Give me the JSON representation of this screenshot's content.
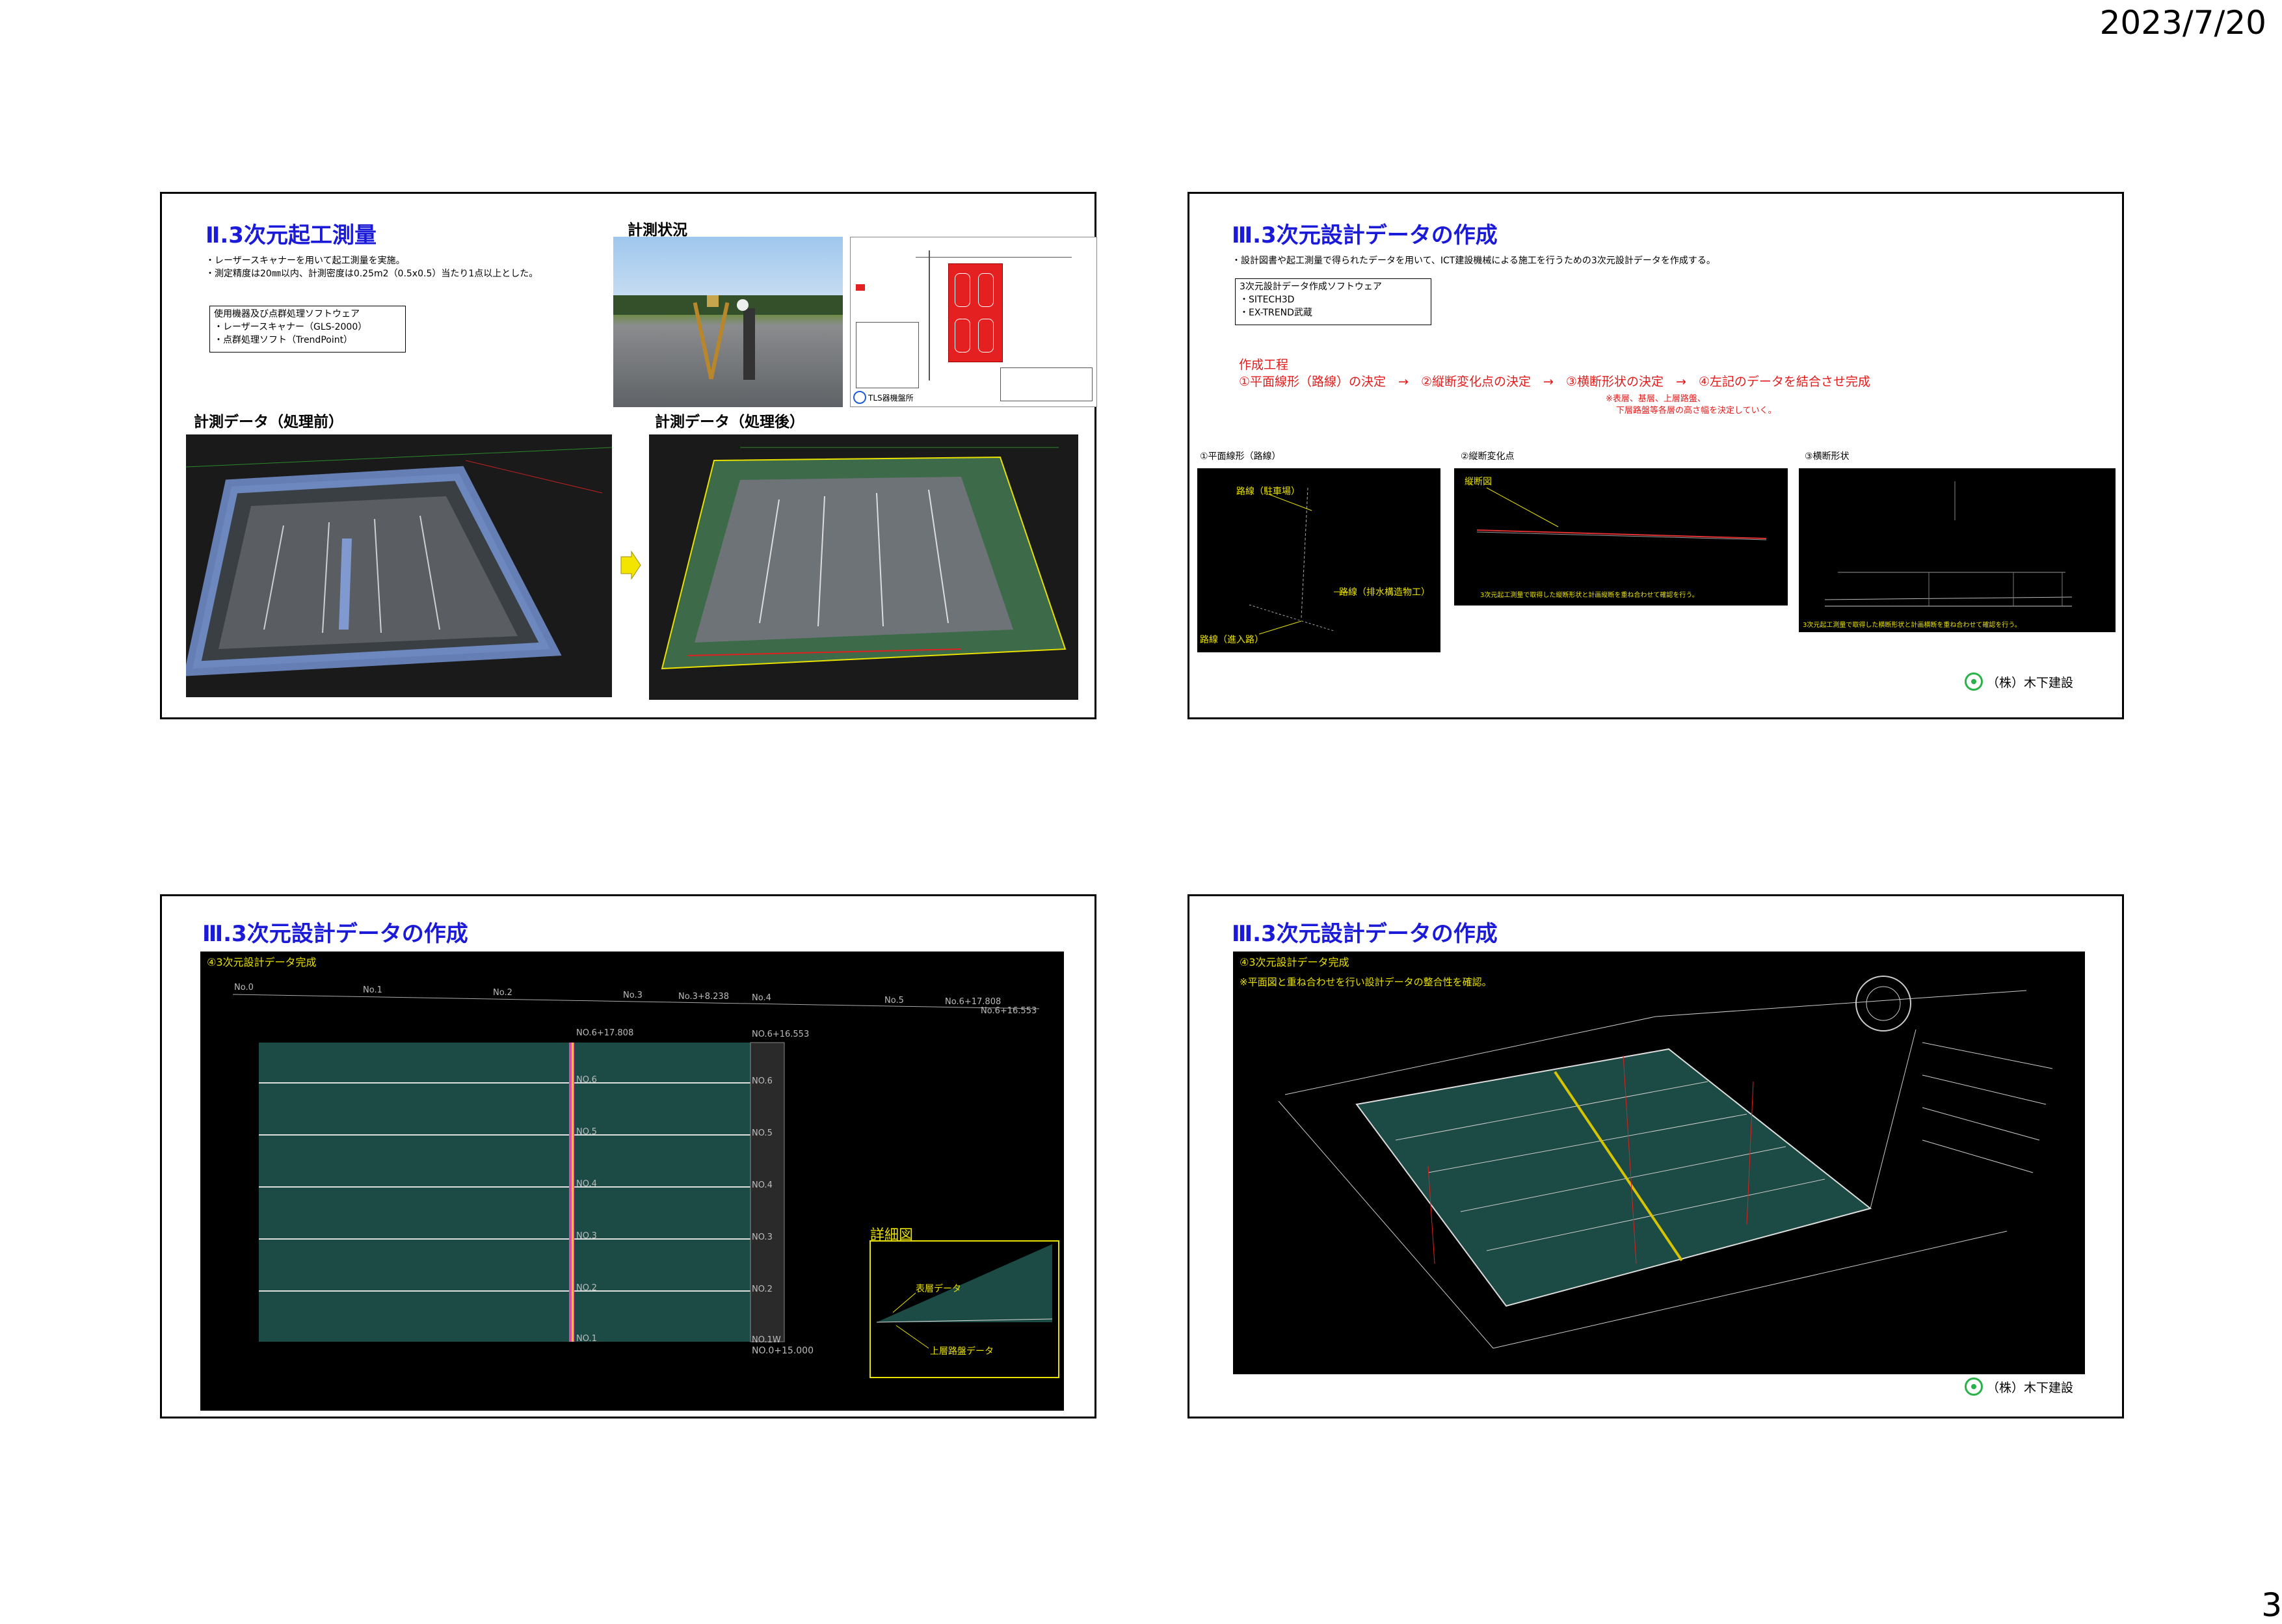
{
  "header": {
    "date": "2023/7/20"
  },
  "footer": {
    "page_number": "3"
  },
  "slide1": {
    "title": "Ⅱ.3次元起工測量",
    "bullets": [
      "・レーザースキャナーを用いて起工測量を実施。",
      "・測定精度は20㎜以内、計測密度は0.25m2（0.5x0.5）当たり1点以上とした。"
    ],
    "equipment_heading": "使用機器及び点群処理ソフトウェア",
    "equipment_items": [
      "・レーザースキャナー（GLS-2000）",
      "・点群処理ソフト（TrendPoint）"
    ],
    "photo_caption": "計測状況",
    "before_caption": "計測データ（処理前）",
    "after_caption": "計測データ（処理後）",
    "tls_label": "TLS器機盤所"
  },
  "slide2": {
    "title": "Ⅲ.3次元設計データの作成",
    "bullet": "・設計図書や起工測量で得られたデータを用いて、ICT建設機械による施工を行うための3次元設計データを作成する。",
    "software_heading": "3次元設計データ作成ソフトウェア",
    "software_items": [
      "・SITECH3D",
      "・EX-TREND武蔵"
    ],
    "process_heading": "作成工程",
    "process_line": "①平面線形（路線）の決定　→　②縦断変化点の決定　→　③横断形状の決定　→　④左記のデータを結合させ完成",
    "process_note1": "※表層、基層、上層路盤、",
    "process_note2": "下層路盤等各層の高さ幅を決定していく。",
    "panel1_caption": "①平面線形（路線）",
    "panel2_caption": "②縦断変化点",
    "panel3_caption": "③横断形状",
    "panel1_labels": [
      "路線（駐車場）",
      "路線（排水構造物工）",
      "路線（進入路）"
    ],
    "panel2_label": "縦断図",
    "panel2_note": "3次元起工測量で取得した縦断形状と計画縦断を重ね合わせて確認を行う。",
    "panel3_note": "3次元起工測量で取得した横断形状と計画横断を重ね合わせて確認を行う。",
    "company": "（株）木下建設"
  },
  "slide3": {
    "title": "Ⅲ.3次元設計データの作成",
    "subtitle": "④3次元設計データ完成",
    "stations_top": [
      "No.0",
      "No.1",
      "No.2",
      "No.3",
      "No.3+8.238",
      "No.4",
      "No.5",
      "No.6+17.808",
      "No.6+16.553"
    ],
    "stations_mid": [
      "NO.6+17.808",
      "NO.6",
      "NO.5",
      "NO.4",
      "NO.3",
      "NO.2",
      "NO.1"
    ],
    "stations_right": [
      "NO.6+16.553",
      "NO.6",
      "NO.5",
      "NO.4",
      "NO.3",
      "NO.2",
      "NO.1W",
      "NO.0+15.000"
    ],
    "detail_title": "詳細図",
    "detail_label1": "表層データ",
    "detail_label2": "上層路盤データ"
  },
  "slide4": {
    "title": "Ⅲ.3次元設計データの作成",
    "subtitle": "④3次元設計データ完成",
    "note": "※平面図と重ね合わせを行い設計データの整合性を確認。",
    "company": "（株）木下建設"
  },
  "colors": {
    "title_blue": "#1a1ad8",
    "label_yellow": "#e8e000",
    "accent_red": "#e41b1b",
    "logo_green": "#2ab24a"
  }
}
